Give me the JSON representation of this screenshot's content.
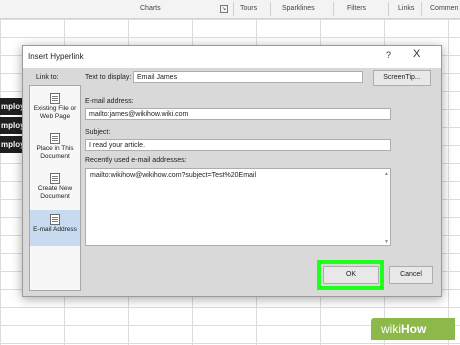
{
  "ribbon": {
    "groups": [
      "Charts",
      "Tours",
      "Sparklines",
      "Filters",
      "Links",
      "Commen"
    ]
  },
  "sheet": {
    "cell_texts": [
      "mploy",
      "mploy",
      "mploy"
    ]
  },
  "dialog": {
    "title": "Insert Hyperlink",
    "help": "?",
    "close": "X",
    "link_to_label": "Link to:",
    "link_to_items": [
      {
        "label": "Existing File or Web Page",
        "icon": "web-page-icon"
      },
      {
        "label": "Place in This Document",
        "icon": "place-document-icon"
      },
      {
        "label": "Create New Document",
        "icon": "new-document-icon"
      },
      {
        "label": "E-mail Address",
        "icon": "email-icon",
        "selected": true
      }
    ],
    "text_to_display_label": "Text to display:",
    "text_to_display_value": "Email James",
    "screentip_button": "ScreenTip...",
    "email_label": "E-mail address:",
    "email_value": "mailto:james@wikihow.wiki.com",
    "subject_label": "Subject:",
    "subject_value": "I read your article.",
    "recent_label": "Recently used e-mail addresses:",
    "recent_items": [
      "mailto:wikihow@wikihow.com?subject=Test%20Email"
    ],
    "ok_button": "OK",
    "cancel_button": "Cancel"
  },
  "watermark": {
    "part1": "wiki",
    "part2": "How"
  },
  "colors": {
    "highlight": "#1eff1e",
    "selected_item": "#c7daf0",
    "watermark": "#8db84a"
  }
}
